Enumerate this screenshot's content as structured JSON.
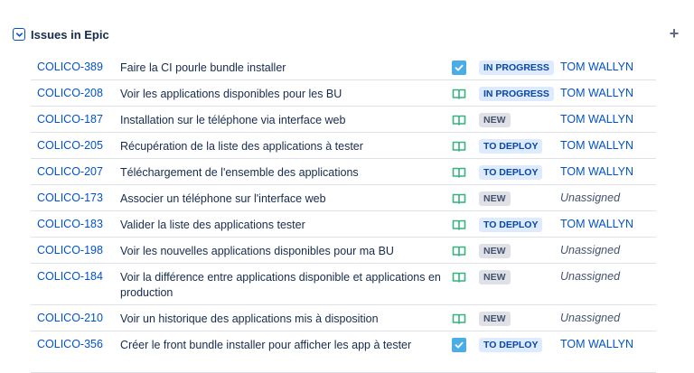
{
  "panel": {
    "title": "Issues in Epic",
    "add_icon": "plus-icon"
  },
  "colors": {
    "link": "#0052cc",
    "story": "#36b37e",
    "task": "#4bade8"
  },
  "issues": [
    {
      "key": "COLICO-389",
      "summary": "Faire la CI pourle bundle installer",
      "type": "task",
      "status": "IN PROGRESS",
      "assignee": "TOM WALLYN"
    },
    {
      "key": "COLICO-208",
      "summary": "Voir les applications disponibles pour les BU",
      "type": "story",
      "status": "IN PROGRESS",
      "assignee": "TOM WALLYN"
    },
    {
      "key": "COLICO-187",
      "summary": "Installation sur le téléphone via interface web",
      "type": "story",
      "status": "NEW",
      "assignee": "TOM WALLYN"
    },
    {
      "key": "COLICO-205",
      "summary": "Récupération de la liste des applications à tester",
      "type": "story",
      "status": "TO DEPLOY",
      "assignee": "TOM WALLYN"
    },
    {
      "key": "COLICO-207",
      "summary": "Téléchargement de l'ensemble des applications",
      "type": "story",
      "status": "TO DEPLOY",
      "assignee": "TOM WALLYN"
    },
    {
      "key": "COLICO-173",
      "summary": "Associer un téléphone sur l'interface web",
      "type": "story",
      "status": "NEW",
      "assignee": "Unassigned"
    },
    {
      "key": "COLICO-183",
      "summary": "Valider la liste des applications tester",
      "type": "story",
      "status": "TO DEPLOY",
      "assignee": "TOM WALLYN"
    },
    {
      "key": "COLICO-198",
      "summary": "Voir les nouvelles applications disponibles pour ma BU",
      "type": "story",
      "status": "NEW",
      "assignee": "Unassigned"
    },
    {
      "key": "COLICO-184",
      "summary": "Voir la différence entre applications disponible et applications en production",
      "type": "story",
      "status": "NEW",
      "assignee": "Unassigned"
    },
    {
      "key": "COLICO-210",
      "summary": "Voir un historique des applications mis à disposition",
      "type": "story",
      "status": "NEW",
      "assignee": "Unassigned"
    },
    {
      "key": "COLICO-356",
      "summary": "Créer le front bundle installer pour afficher les app à tester",
      "type": "task",
      "status": "TO DEPLOY",
      "assignee": "TOM WALLYN"
    }
  ]
}
